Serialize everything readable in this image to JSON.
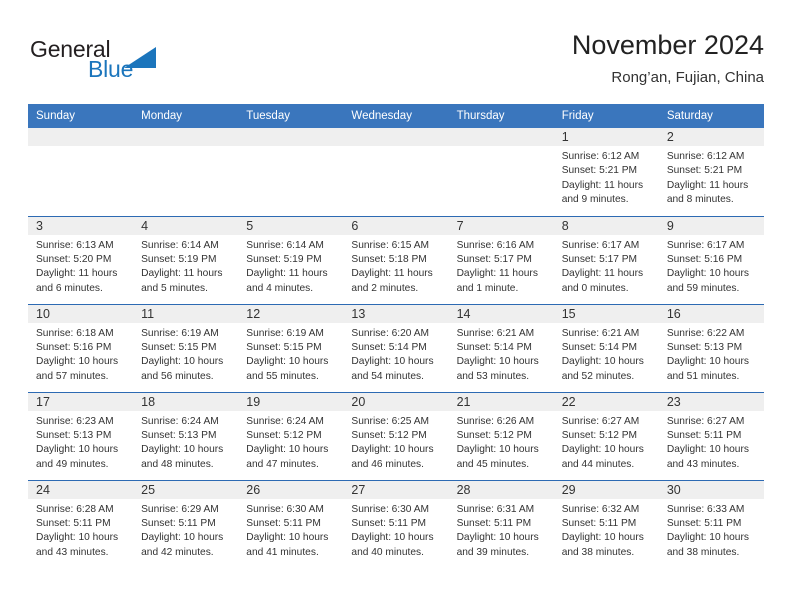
{
  "brand": {
    "word_one": "General",
    "word_two": "Blue",
    "triangle_color": "#1b75bc",
    "text_color": "#231f20"
  },
  "header": {
    "title": "November 2024",
    "subtitle": "Rong’an, Fujian, China"
  },
  "colors": {
    "header_blue": "#3a76bd",
    "row_rule_blue": "#2d6ab3",
    "daynum_band": "#efefef",
    "text": "#333333"
  },
  "weekday_headers": [
    "Sunday",
    "Monday",
    "Tuesday",
    "Wednesday",
    "Thursday",
    "Friday",
    "Saturday"
  ],
  "weeks": [
    [
      {
        "day": "",
        "empty": true,
        "sunrise": "",
        "sunset": "",
        "daylight": ""
      },
      {
        "day": "",
        "empty": true,
        "sunrise": "",
        "sunset": "",
        "daylight": ""
      },
      {
        "day": "",
        "empty": true,
        "sunrise": "",
        "sunset": "",
        "daylight": ""
      },
      {
        "day": "",
        "empty": true,
        "sunrise": "",
        "sunset": "",
        "daylight": ""
      },
      {
        "day": "",
        "empty": true,
        "sunrise": "",
        "sunset": "",
        "daylight": ""
      },
      {
        "day": "1",
        "empty": false,
        "sunrise": "Sunrise: 6:12 AM",
        "sunset": "Sunset: 5:21 PM",
        "daylight": "Daylight: 11 hours and 9 minutes."
      },
      {
        "day": "2",
        "empty": false,
        "sunrise": "Sunrise: 6:12 AM",
        "sunset": "Sunset: 5:21 PM",
        "daylight": "Daylight: 11 hours and 8 minutes."
      }
    ],
    [
      {
        "day": "3",
        "empty": false,
        "sunrise": "Sunrise: 6:13 AM",
        "sunset": "Sunset: 5:20 PM",
        "daylight": "Daylight: 11 hours and 6 minutes."
      },
      {
        "day": "4",
        "empty": false,
        "sunrise": "Sunrise: 6:14 AM",
        "sunset": "Sunset: 5:19 PM",
        "daylight": "Daylight: 11 hours and 5 minutes."
      },
      {
        "day": "5",
        "empty": false,
        "sunrise": "Sunrise: 6:14 AM",
        "sunset": "Sunset: 5:19 PM",
        "daylight": "Daylight: 11 hours and 4 minutes."
      },
      {
        "day": "6",
        "empty": false,
        "sunrise": "Sunrise: 6:15 AM",
        "sunset": "Sunset: 5:18 PM",
        "daylight": "Daylight: 11 hours and 2 minutes."
      },
      {
        "day": "7",
        "empty": false,
        "sunrise": "Sunrise: 6:16 AM",
        "sunset": "Sunset: 5:17 PM",
        "daylight": "Daylight: 11 hours and 1 minute."
      },
      {
        "day": "8",
        "empty": false,
        "sunrise": "Sunrise: 6:17 AM",
        "sunset": "Sunset: 5:17 PM",
        "daylight": "Daylight: 11 hours and 0 minutes."
      },
      {
        "day": "9",
        "empty": false,
        "sunrise": "Sunrise: 6:17 AM",
        "sunset": "Sunset: 5:16 PM",
        "daylight": "Daylight: 10 hours and 59 minutes."
      }
    ],
    [
      {
        "day": "10",
        "empty": false,
        "sunrise": "Sunrise: 6:18 AM",
        "sunset": "Sunset: 5:16 PM",
        "daylight": "Daylight: 10 hours and 57 minutes."
      },
      {
        "day": "11",
        "empty": false,
        "sunrise": "Sunrise: 6:19 AM",
        "sunset": "Sunset: 5:15 PM",
        "daylight": "Daylight: 10 hours and 56 minutes."
      },
      {
        "day": "12",
        "empty": false,
        "sunrise": "Sunrise: 6:19 AM",
        "sunset": "Sunset: 5:15 PM",
        "daylight": "Daylight: 10 hours and 55 minutes."
      },
      {
        "day": "13",
        "empty": false,
        "sunrise": "Sunrise: 6:20 AM",
        "sunset": "Sunset: 5:14 PM",
        "daylight": "Daylight: 10 hours and 54 minutes."
      },
      {
        "day": "14",
        "empty": false,
        "sunrise": "Sunrise: 6:21 AM",
        "sunset": "Sunset: 5:14 PM",
        "daylight": "Daylight: 10 hours and 53 minutes."
      },
      {
        "day": "15",
        "empty": false,
        "sunrise": "Sunrise: 6:21 AM",
        "sunset": "Sunset: 5:14 PM",
        "daylight": "Daylight: 10 hours and 52 minutes."
      },
      {
        "day": "16",
        "empty": false,
        "sunrise": "Sunrise: 6:22 AM",
        "sunset": "Sunset: 5:13 PM",
        "daylight": "Daylight: 10 hours and 51 minutes."
      }
    ],
    [
      {
        "day": "17",
        "empty": false,
        "sunrise": "Sunrise: 6:23 AM",
        "sunset": "Sunset: 5:13 PM",
        "daylight": "Daylight: 10 hours and 49 minutes."
      },
      {
        "day": "18",
        "empty": false,
        "sunrise": "Sunrise: 6:24 AM",
        "sunset": "Sunset: 5:13 PM",
        "daylight": "Daylight: 10 hours and 48 minutes."
      },
      {
        "day": "19",
        "empty": false,
        "sunrise": "Sunrise: 6:24 AM",
        "sunset": "Sunset: 5:12 PM",
        "daylight": "Daylight: 10 hours and 47 minutes."
      },
      {
        "day": "20",
        "empty": false,
        "sunrise": "Sunrise: 6:25 AM",
        "sunset": "Sunset: 5:12 PM",
        "daylight": "Daylight: 10 hours and 46 minutes."
      },
      {
        "day": "21",
        "empty": false,
        "sunrise": "Sunrise: 6:26 AM",
        "sunset": "Sunset: 5:12 PM",
        "daylight": "Daylight: 10 hours and 45 minutes."
      },
      {
        "day": "22",
        "empty": false,
        "sunrise": "Sunrise: 6:27 AM",
        "sunset": "Sunset: 5:12 PM",
        "daylight": "Daylight: 10 hours and 44 minutes."
      },
      {
        "day": "23",
        "empty": false,
        "sunrise": "Sunrise: 6:27 AM",
        "sunset": "Sunset: 5:11 PM",
        "daylight": "Daylight: 10 hours and 43 minutes."
      }
    ],
    [
      {
        "day": "24",
        "empty": false,
        "sunrise": "Sunrise: 6:28 AM",
        "sunset": "Sunset: 5:11 PM",
        "daylight": "Daylight: 10 hours and 43 minutes."
      },
      {
        "day": "25",
        "empty": false,
        "sunrise": "Sunrise: 6:29 AM",
        "sunset": "Sunset: 5:11 PM",
        "daylight": "Daylight: 10 hours and 42 minutes."
      },
      {
        "day": "26",
        "empty": false,
        "sunrise": "Sunrise: 6:30 AM",
        "sunset": "Sunset: 5:11 PM",
        "daylight": "Daylight: 10 hours and 41 minutes."
      },
      {
        "day": "27",
        "empty": false,
        "sunrise": "Sunrise: 6:30 AM",
        "sunset": "Sunset: 5:11 PM",
        "daylight": "Daylight: 10 hours and 40 minutes."
      },
      {
        "day": "28",
        "empty": false,
        "sunrise": "Sunrise: 6:31 AM",
        "sunset": "Sunset: 5:11 PM",
        "daylight": "Daylight: 10 hours and 39 minutes."
      },
      {
        "day": "29",
        "empty": false,
        "sunrise": "Sunrise: 6:32 AM",
        "sunset": "Sunset: 5:11 PM",
        "daylight": "Daylight: 10 hours and 38 minutes."
      },
      {
        "day": "30",
        "empty": false,
        "sunrise": "Sunrise: 6:33 AM",
        "sunset": "Sunset: 5:11 PM",
        "daylight": "Daylight: 10 hours and 38 minutes."
      }
    ]
  ]
}
